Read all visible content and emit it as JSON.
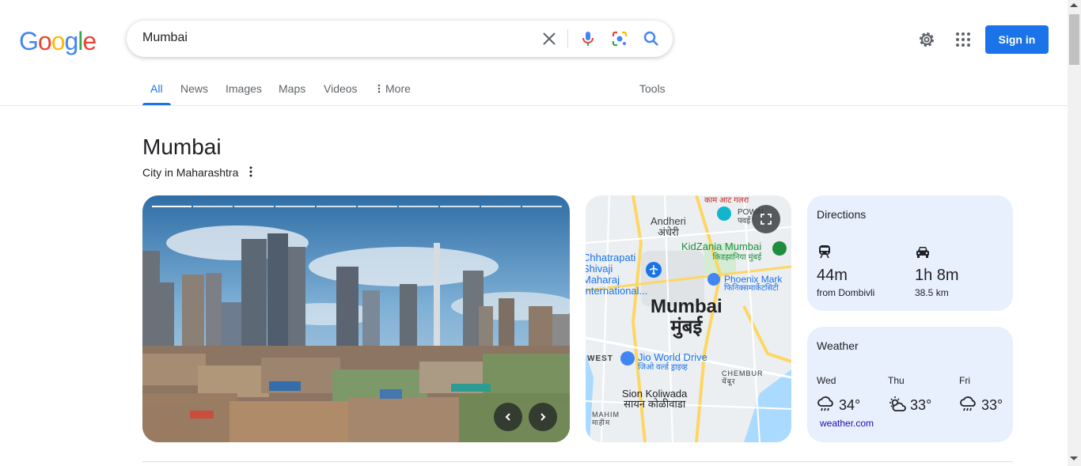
{
  "logo": {
    "letters": [
      "G",
      "o",
      "o",
      "g",
      "l",
      "e"
    ],
    "colors": [
      "#4285F4",
      "#EA4335",
      "#FBBC05",
      "#4285F4",
      "#34A853",
      "#EA4335"
    ]
  },
  "search": {
    "value": "Mumbai",
    "placeholder": ""
  },
  "header": {
    "signin_label": "Sign in"
  },
  "tabs": [
    {
      "label": "All",
      "active": true
    },
    {
      "label": "News"
    },
    {
      "label": "Images"
    },
    {
      "label": "Maps"
    },
    {
      "label": "Videos"
    },
    {
      "label": "More"
    }
  ],
  "tools_label": "Tools",
  "knowledge_panel": {
    "title": "Mumbai",
    "subtitle": "City in Maharashtra"
  },
  "map": {
    "city_label": "Mumbai",
    "city_label_local": "मुंबई",
    "places": [
      {
        "name": "Andheri",
        "local": "अंधेरी"
      },
      {
        "name": "KidZania Mumbai",
        "local": "किडझानिया मुंबई"
      },
      {
        "name": "Phoenix Mark",
        "local": "फिनिक्समार्केटसिटी"
      },
      {
        "name": "Chhatrapati Shivaji Maharaj International...",
        "local": ""
      },
      {
        "name": "Jio World Drive",
        "local": "जिओ वर्ल्ड ड्राइव्ह"
      },
      {
        "name": "Sion Koliwada",
        "local": "सायन कोळीवाडा"
      },
      {
        "name": "CHEMBUR",
        "local": "चेंबूर"
      },
      {
        "name": "WEST",
        "local": ""
      },
      {
        "name": "MAHIM",
        "local": "माहीम"
      },
      {
        "name": "POWAI",
        "local": "पवई"
      },
      {
        "name": "काम आट गलरा",
        "local": ""
      }
    ]
  },
  "directions": {
    "title": "Directions",
    "train_time": "44m",
    "train_from": "from Dombivli",
    "car_time": "1h 8m",
    "car_distance": "38.5 km"
  },
  "weather": {
    "title": "Weather",
    "days": [
      {
        "day": "Wed",
        "temp": "34°",
        "icon": "rain-cloud-icon"
      },
      {
        "day": "Thu",
        "temp": "33°",
        "icon": "partly-sunny-icon"
      },
      {
        "day": "Fri",
        "temp": "33°",
        "icon": "rain-cloud-icon"
      }
    ],
    "source": "weather.com"
  },
  "colors": {
    "accent": "#1a73e8",
    "card_bg": "#e8f0fe"
  }
}
